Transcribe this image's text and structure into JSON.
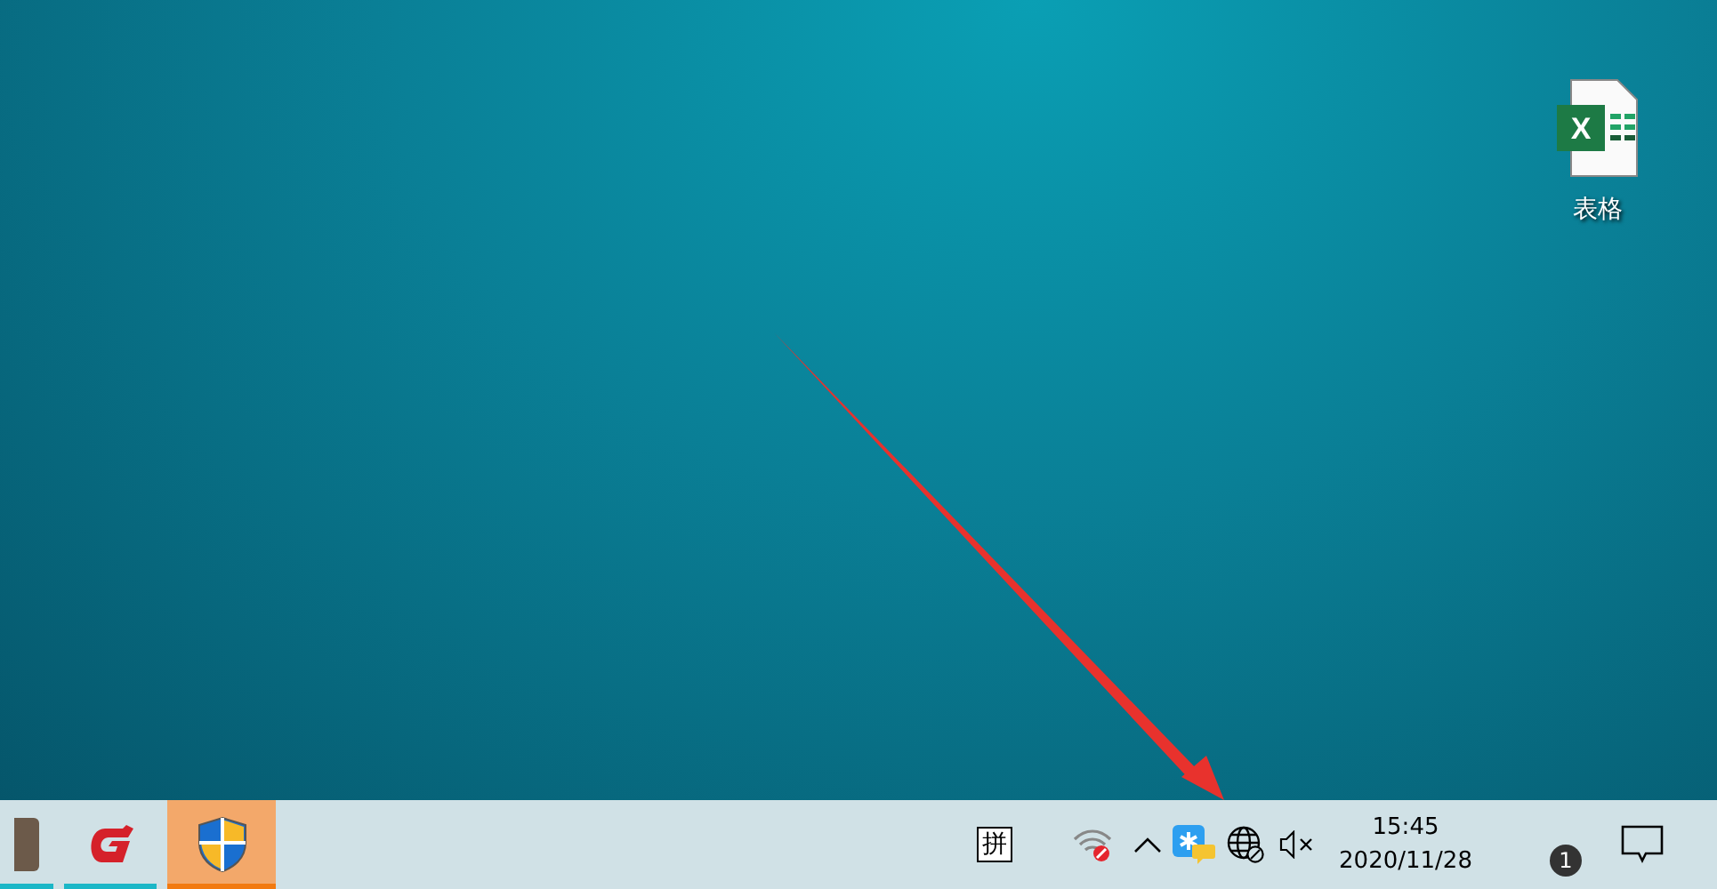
{
  "desktop_icons": [
    {
      "label": "表格",
      "badge_letter": "X"
    }
  ],
  "taskbar": {
    "apps": [
      {
        "kind": "photo",
        "selected": false,
        "running": true
      },
      {
        "kind": "red-g",
        "selected": false,
        "running": true
      },
      {
        "kind": "shield",
        "selected": true,
        "running": true
      }
    ],
    "tray": {
      "ime": "拼",
      "time": "15:45",
      "date": "2020/11/28",
      "notification_count": "1"
    }
  }
}
